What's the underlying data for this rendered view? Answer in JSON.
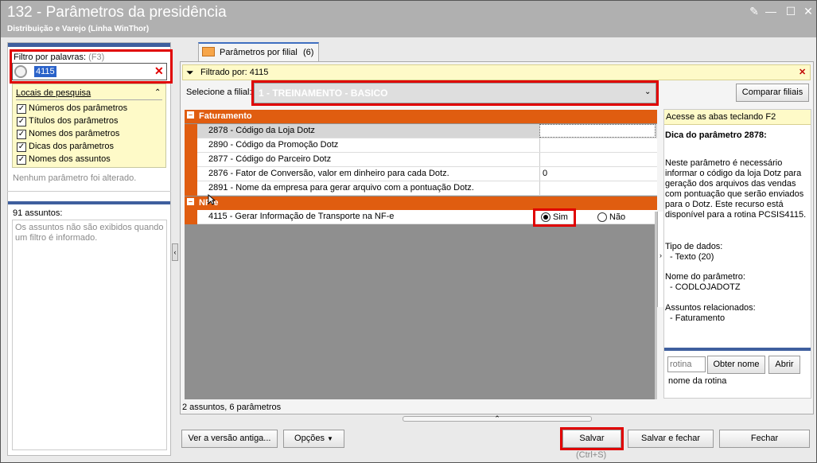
{
  "window": {
    "title": "132 - Parâmetros da presidência",
    "subtitle": "Distribuição e Varejo (Linha WinThor)"
  },
  "left": {
    "filter_label": "Filtro por palavras:",
    "filter_shortcut": "(F3)",
    "search_value": "4115",
    "locations_title": "Locais de pesquisa",
    "locations": [
      {
        "label": "Números dos parâmetros",
        "checked": true
      },
      {
        "label": "Títulos dos parâmetros",
        "checked": true
      },
      {
        "label": "Nomes dos parâmetros",
        "checked": true
      },
      {
        "label": "Dicas dos parâmetros",
        "checked": true
      },
      {
        "label": "Nomes dos assuntos",
        "checked": true
      }
    ],
    "no_change": "Nenhum parâmetro foi alterado.",
    "subjects_count": "91 assuntos:",
    "subjects_note": "Os assuntos não são exibidos quando um filtro é informado."
  },
  "tab": {
    "label": "Parâmetros por filial",
    "count": "(6)"
  },
  "filter_bar": {
    "text": "Filtrado por: 4115"
  },
  "branch": {
    "label": "Selecione a filial:",
    "value": "1 - TREINAMENTO - BASICO",
    "compare_button": "Comparar filiais"
  },
  "grid": {
    "categories": [
      {
        "name": "Faturamento",
        "rows": [
          {
            "name": "2878 - Código da Loja Dotz",
            "value": ""
          },
          {
            "name": "2890 - Código da Promoção Dotz",
            "value": ""
          },
          {
            "name": "2877 - Código do Parceiro Dotz",
            "value": ""
          },
          {
            "name": "2876 - Fator de Conversão, valor em dinheiro para cada Dotz.",
            "value": "0"
          },
          {
            "name": "2891 - Nome da empresa para gerar arquivo com a pontuação Dotz.",
            "value": ""
          }
        ]
      },
      {
        "name": "NF-e",
        "rows": [
          {
            "name": "4115 - Gerar Informação de Transporte na NF-e",
            "yes": "Sim",
            "no": "Não",
            "selected": "Sim"
          }
        ]
      }
    ],
    "status": "2 assuntos, 6 parâmetros"
  },
  "right": {
    "hint": "Acesse as abas teclando F2",
    "tip_title": "Dica do parâmetro 2878:",
    "tip_body": "Neste parâmetro é necessário informar o código da loja Dotz para geração dos arquivos das vendas com pontuação que serão enviados para o Dotz. Este recurso está disponível para a rotina PCSIS4115.",
    "data_type_label": "Tipo de dados:",
    "data_type_value": "- Texto (20)",
    "param_name_label": "Nome do parâmetro:",
    "param_name_value": "- CODLOJADOTZ",
    "subjects_label": "Assuntos relacionados:",
    "subjects_value": "- Faturamento",
    "rotina_placeholder": "rotina",
    "get_name_button": "Obter nome",
    "open_button": "Abrir",
    "rotina_name": "nome da rotina"
  },
  "footer": {
    "old_version_button": "Ver a versão antiga...",
    "options_button": "Opções",
    "save_button": "Salvar",
    "save_shortcut": "(Ctrl+S)",
    "save_close_button": "Salvar e fechar",
    "close_button": "Fechar"
  }
}
